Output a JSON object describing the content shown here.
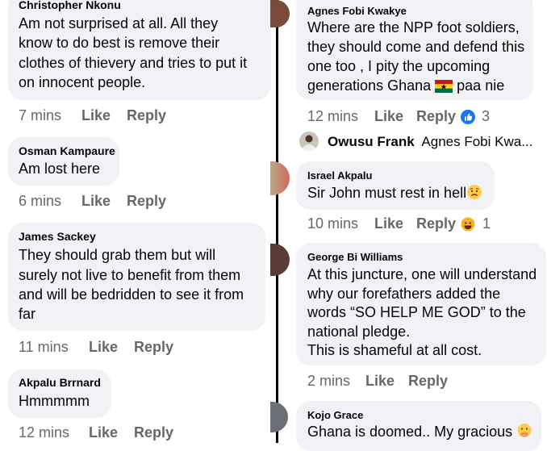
{
  "left": {
    "comments": [
      {
        "author": "Christopher Nkonu",
        "lines": [
          "Am not surprised at all. All they",
          "know to do best is remove their",
          "clothes of thievery and tries to put it",
          "on innocent people."
        ],
        "time": "7 mins",
        "like": "Like",
        "reply": "Reply"
      },
      {
        "author": "Osman Kampaure",
        "lines": [
          "Am lost here"
        ],
        "time": "6 mins",
        "like": "Like",
        "reply": "Reply"
      },
      {
        "author": "James Sackey",
        "lines": [
          "They should grab them but will",
          "surely not live to benefit from them",
          "and will be bedridden to see it from",
          "far"
        ],
        "time": "11 mins",
        "like": "Like",
        "reply": "Reply"
      },
      {
        "author": "Akpalu Brrnard",
        "lines": [
          "Hmmmmm"
        ],
        "time": "12 mins",
        "like": "Like",
        "reply": "Reply"
      }
    ]
  },
  "right": {
    "comments": [
      {
        "author": "Agnes Fobi Kwakye",
        "lines": [
          "Where are the NPP foot soldiers,",
          "they should come and defend this",
          "one too , I pity the upcoming",
          "generations Ghana",
          "paa nie"
        ],
        "time": "12 mins",
        "like": "Like",
        "reply": "Reply",
        "reaction_count": "3"
      },
      {
        "author": "Israel Akpalu",
        "lines": [
          "Sir John must rest in hell"
        ],
        "time": "10 mins",
        "like": "Like",
        "reply": "Reply",
        "reaction_count": "1"
      },
      {
        "author": "George Bi Williams",
        "lines": [
          "At this juncture, one will understand",
          "why our forefathers added the",
          "words “SO HELP ME GOD” to the",
          "national pledge.",
          "This is shameful at all cost."
        ],
        "time": "2 mins",
        "like": "Like",
        "reply": "Reply"
      },
      {
        "author": "Kojo Grace",
        "lines": [
          "Ghana is doomed.. My gracious"
        ]
      }
    ],
    "reply_preview": {
      "author": "Owusu Frank",
      "snippet": "Agnes Fobi Kwa..."
    }
  },
  "colors": {
    "bubble": "#f0f2f5",
    "meta": "#65676b",
    "text": "#050505",
    "like_blue": "#1877f2",
    "divider": "#000000"
  },
  "icons": [
    "thumbs-up-reaction-icon",
    "haha-reaction-icon",
    "ghana-flag-emoji",
    "worried-face-emoji",
    "hand-over-mouth-emoji"
  ]
}
